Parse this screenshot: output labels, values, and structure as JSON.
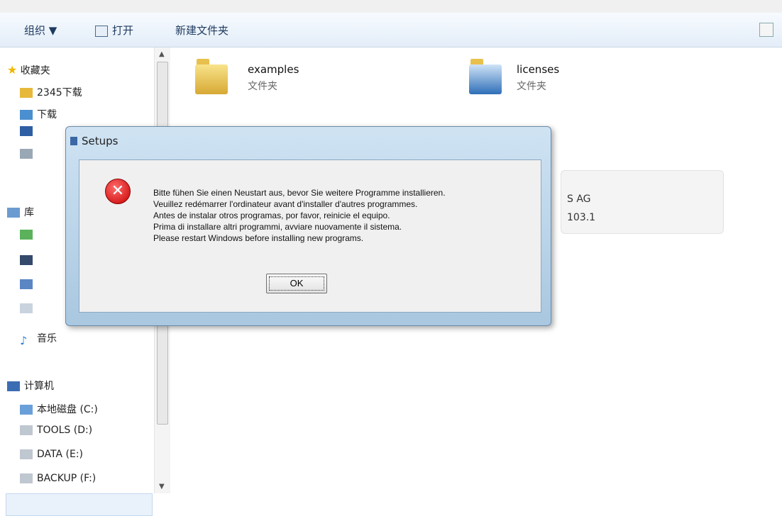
{
  "toolbar": {
    "organize_label": "组织 ▼",
    "open_label": "打开",
    "new_folder_label": "新建文件夹"
  },
  "nav": {
    "favorites_header": "收藏夹",
    "items": [
      {
        "label": "2345下载"
      },
      {
        "label": "下载"
      },
      {
        "label": "库"
      },
      {
        "label": "音乐"
      },
      {
        "label": "计算机"
      },
      {
        "label": "本地磁盘 (C:)"
      },
      {
        "label": "TOOLS (D:)"
      },
      {
        "label": "DATA (E:)"
      },
      {
        "label": "BACKUP (F:)"
      }
    ]
  },
  "content": {
    "folders": [
      {
        "name": "examples",
        "type": "文件夹"
      },
      {
        "name": "licenses",
        "type": "文件夹"
      }
    ],
    "card": {
      "line1": "S AG",
      "line2": "103.1"
    }
  },
  "dialog": {
    "title": "Setups",
    "message_lines": [
      "Bitte fühen Sie einen Neustart aus, bevor Sie weitere Programme installieren.",
      "Veuillez redémarrer l'ordinateur avant d'installer d'autres programmes.",
      "Antes de instalar otros programas, por favor, reinicie el equipo.",
      "Prima di installare altri programmi, avviare nuovamente il sistema.",
      "Please restart Windows before installing new programs."
    ],
    "ok_label": "OK"
  },
  "colors": {
    "error_red": "#c80000",
    "folder_yellow": "#d7a934",
    "dialog_blue": "#a9c7e0"
  }
}
